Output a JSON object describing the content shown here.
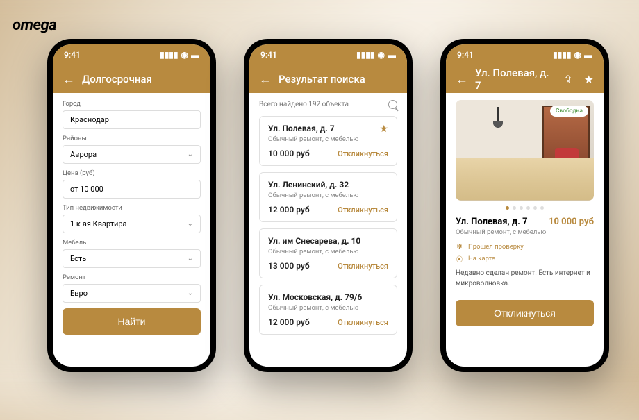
{
  "brand": "omega",
  "status": {
    "time": "9:41"
  },
  "screen1": {
    "title": "Долгосрочная",
    "fields": {
      "city_label": "Город",
      "city_value": "Краснодар",
      "district_label": "Районы",
      "district_value": "Аврора",
      "price_label": "Цена (руб)",
      "price_value": "от 10 000",
      "type_label": "Тип недвижимости",
      "type_value": "1 к-ая Квартира",
      "furniture_label": "Мебель",
      "furniture_value": "Есть",
      "repair_label": "Ремонт",
      "repair_value": "Евро"
    },
    "submit": "Найти"
  },
  "screen2": {
    "title": "Результат поиска",
    "count_text": "Всего найдено 192 объекта",
    "items": [
      {
        "addr": "Ул. Полевая, д. 7",
        "sub": "Обычный ремонт, с мебелью",
        "price": "10 000 руб",
        "cta": "Откликнуться",
        "starred": true
      },
      {
        "addr": "Ул. Ленинский, д. 32",
        "sub": "Обычный ремонт, с мебелью",
        "price": "12 000 руб",
        "cta": "Откликнуться",
        "starred": false
      },
      {
        "addr": "Ул. им Снесарева, д. 10",
        "sub": "Обычный ремонт, с мебелью",
        "price": "13 000 руб",
        "cta": "Откликнуться",
        "starred": false
      },
      {
        "addr": "Ул. Московская, д. 79/6",
        "sub": "Обычный ремонт, с мебелью",
        "price": "12 000 руб",
        "cta": "Откликнуться",
        "starred": false
      }
    ]
  },
  "screen3": {
    "title": "Ул. Полевая, д. 7",
    "badge": "Свободна",
    "addr": "Ул. Полевая, д. 7",
    "price": "10 000 руб",
    "sub": "Обычный ремонт, с мебелью",
    "verified": "Прошел проверку",
    "map": "На карте",
    "desc": "Недавно сделан ремонт. Есть интернет и микроволновка.",
    "cta": "Откликнуться"
  }
}
